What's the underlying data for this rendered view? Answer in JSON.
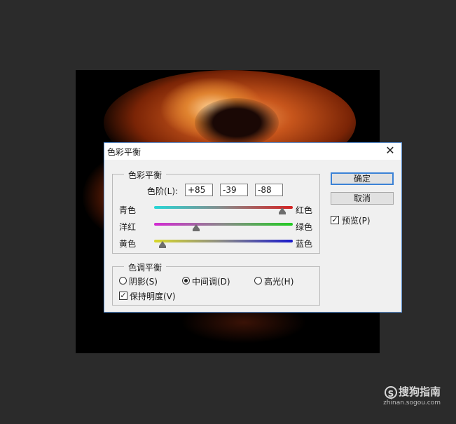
{
  "dialog": {
    "title": "色彩平衡",
    "close_glyph": "✕"
  },
  "color_balance": {
    "legend": "色彩平衡",
    "levels_label": "色阶(L):",
    "levels": [
      "+85",
      "-39",
      "-88"
    ],
    "sliders": [
      {
        "left": "青色",
        "right": "红色",
        "value": 85,
        "colors": [
          "#27d6d6",
          "#d42222"
        ]
      },
      {
        "left": "洋红",
        "right": "绿色",
        "value": -39,
        "colors": [
          "#d22ad2",
          "#22cc22"
        ]
      },
      {
        "left": "黄色",
        "right": "蓝色",
        "value": -88,
        "colors": [
          "#d8d82a",
          "#1a1acc"
        ]
      }
    ]
  },
  "tone_balance": {
    "legend": "色调平衡",
    "options": [
      "阴影(S)",
      "中间调(D)",
      "高光(H)"
    ],
    "selected": "中间调(D)",
    "preserve_luminosity": "保持明度(V)",
    "preserve_checked": true
  },
  "buttons": {
    "ok": "确定",
    "cancel": "取消"
  },
  "preview": {
    "label": "预览(P)",
    "checked": true
  },
  "watermark": {
    "logo_letter": "S",
    "name": "搜狗指南",
    "url": "zhinan.sogou.com"
  },
  "colors": {
    "accent": "#3b82d6",
    "canvas_bg": "#000000",
    "app_bg": "#2b2b2b"
  }
}
